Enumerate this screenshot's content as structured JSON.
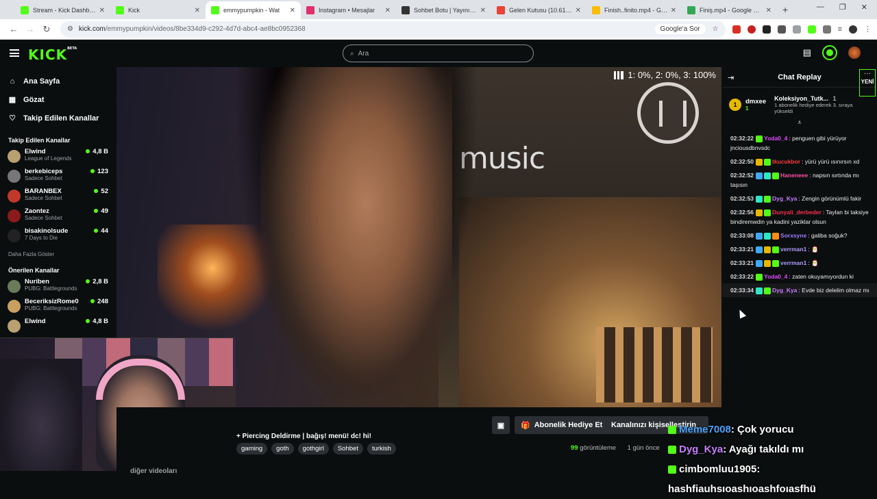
{
  "browser": {
    "tabs": [
      {
        "label": "Stream - Kick Dashboard",
        "fav_color": "#53fc18",
        "active": false
      },
      {
        "label": "Kick",
        "fav_color": "#53fc18",
        "active": false
      },
      {
        "label": "emmypumpkin - Wat",
        "fav_color": "#53fc18",
        "active": true
      },
      {
        "label": "Instagram • Mesajlar",
        "fav_color": "#e1306c",
        "active": false
      },
      {
        "label": "Sohbet Botu | Yayınını güç",
        "fav_color": "#333333",
        "active": false
      },
      {
        "label": "Gelen Kutusu (10.618) - g",
        "fav_color": "#ea4335",
        "active": false
      },
      {
        "label": "Finish..finito.mp4 - Google",
        "fav_color": "#fbbc04",
        "active": false
      },
      {
        "label": "Finiş.mp4 - Google Drive",
        "fav_color": "#34a853",
        "active": false
      }
    ],
    "url_host": "kick.com",
    "url_path": "/emmypumpkin/videos/8be334d9-c292-4d7d-abc4-ae8bc0952368",
    "google_button": "Google'a Sor"
  },
  "kick": {
    "logo": "KICK",
    "logo_badge": "BETA",
    "search_placeholder": "Ara",
    "accent": "#53fc18"
  },
  "sidebar": {
    "nav": [
      {
        "label": "Ana Sayfa",
        "icon": "home-icon"
      },
      {
        "label": "Gözat",
        "icon": "browse-icon"
      },
      {
        "label": "Takip Edilen Kanallar",
        "icon": "heart-icon"
      }
    ],
    "following_title": "Takip Edilen Kanallar",
    "following": [
      {
        "name": "Elwind",
        "game": "League of Legends",
        "viewers": "4,8 B",
        "color": "#b8a070"
      },
      {
        "name": "berkebiceps",
        "game": "Sadece Sohbet",
        "viewers": "123",
        "color": "#777777"
      },
      {
        "name": "BARANBEX",
        "game": "Sadece Sohbet",
        "viewers": "52",
        "color": "#c0392b"
      },
      {
        "name": "Zaontez",
        "game": "Sadece Sohbet",
        "viewers": "49",
        "color": "#8b1a1a"
      },
      {
        "name": "bisakinolsude",
        "game": "7 Days to Die",
        "viewers": "44",
        "color": "#222222"
      }
    ],
    "show_more": "Daha Fazla Göster",
    "recommended_title": "Önerilen Kanallar",
    "recommended": [
      {
        "name": "Nuriben",
        "game": "PUBG: Battlegrounds",
        "viewers": "2,8 B",
        "color": "#6a7a5a"
      },
      {
        "name": "BeceriksizRome0",
        "game": "PUBG: Battlegrounds",
        "viewers": "248",
        "color": "#c9a060"
      },
      {
        "name": "Elwind",
        "game": "",
        "viewers": "4,8 B",
        "color": "#b8a070"
      }
    ]
  },
  "video": {
    "quality": "1: 0%, 2: 0%, 3: 100%"
  },
  "chat": {
    "title": "Chat Replay",
    "dots": "···",
    "new_badge": "YENİ",
    "pinned_user": "dmxee",
    "pinned_user_count": "1",
    "pinned_rank": "1",
    "pinned_title": "Koleksiyon_Tutk...",
    "pinned_title_count": "1",
    "pinned_sub": "1 abonelik hediye ederek 3. sıraya yükseldi",
    "messages": [
      {
        "ts": "02:32:22",
        "user": "Yoda0_4",
        "color": "#e04cff",
        "badges": [
          "#53fc18"
        ],
        "text": "penguen gibi yürüyor jnciousdbnvsdc"
      },
      {
        "ts": "02:32:50",
        "user": "tkucukbor",
        "color": "#ff3b3b",
        "badges": [
          "#e6b800",
          "#53fc18"
        ],
        "text": "yürü yürü ısınırsın xd"
      },
      {
        "ts": "02:32:52",
        "user": "Haneneee",
        "color": "#ff4fa3",
        "badges": [
          "#3fa9f5",
          "#2ee6c2",
          "#53fc18"
        ],
        "text": "napsın sırtında mı taşısın"
      },
      {
        "ts": "02:32:53",
        "user": "Dyg_Kya",
        "color": "#c77dff",
        "badges": [
          "#2ee6c2",
          "#53fc18"
        ],
        "text": "Zengin görünümlü fakir"
      },
      {
        "ts": "02:32:56",
        "user": "Dunyali_derbeder",
        "color": "#ff2e4d",
        "badges": [
          "#e6b800",
          "#53fc18"
        ],
        "text": "Taylan bi taksiye bindiremwdin ya kadini yaziklar olsun"
      },
      {
        "ts": "02:33:08",
        "user": "Sorxsyne",
        "color": "#9b7bff",
        "badges": [
          "#3fa9f5",
          "#2ee6c2",
          "#ff8c1a"
        ],
        "text": "galiba soğuk?"
      },
      {
        "ts": "02:33:21",
        "user": "verrman1",
        "color": "#b19cff",
        "badges": [
          "#3fa9f5",
          "#e6b800",
          "#53fc18"
        ],
        "text": "🎅"
      },
      {
        "ts": "02:33:21",
        "user": "verrman1",
        "color": "#b19cff",
        "badges": [
          "#3fa9f5",
          "#e6b800",
          "#53fc18"
        ],
        "text": "🎅"
      },
      {
        "ts": "02:33:22",
        "user": "Yoda0_4",
        "color": "#e04cff",
        "badges": [
          "#53fc18"
        ],
        "text": "zaten okuyamıyordun ki"
      },
      {
        "ts": "02:33:34",
        "user": "Dyg_Kya",
        "color": "#c77dff",
        "badges": [
          "#2ee6c2",
          "#53fc18"
        ],
        "text": "Evde biz delelim olmaz mı"
      }
    ]
  },
  "below": {
    "gift_button": "Abonelik Hediye Et",
    "customize_button": "Kanalınızı kişiselleştirin",
    "stream_title": "+ Piercing Deldirme | bağış! menü! dc! hi!",
    "tags": [
      "gaming",
      "goth",
      "gothgirl",
      "Sohbet",
      "turkish"
    ],
    "views_count": "99",
    "views_label": "görüntüleme",
    "ago": "1 gün önce",
    "other_videos": "diğer videoları"
  },
  "overlay_chat": [
    {
      "user": "Meme7008",
      "color": "#4aa3ff",
      "text": ": Çok yorucu"
    },
    {
      "user": "Dyg_Kya",
      "color": "#c77dff",
      "text": ": Ayağı takıldı mı"
    },
    {
      "user": "cimbomluu1905",
      "color": "#ffffff",
      "text": ": hashfiauhsıoashıoashfoıasfhü"
    }
  ]
}
